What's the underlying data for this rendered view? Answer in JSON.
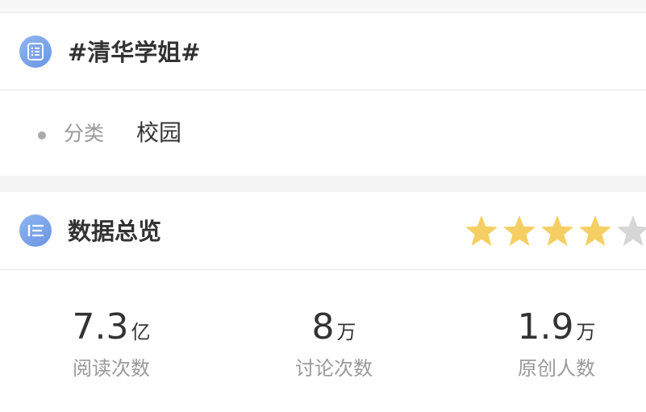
{
  "topic": {
    "title": "#清华学姐#",
    "icon": "document-list-icon"
  },
  "category": {
    "label": "分类",
    "value": "校园"
  },
  "overview": {
    "title": "数据总览",
    "icon": "list-icon",
    "rating": {
      "value": 4,
      "max": 5,
      "filled_color": "#f5cf63",
      "empty_color": "#d6d6d6"
    }
  },
  "stats": [
    {
      "number": "7.3",
      "unit": "亿",
      "label": "阅读次数"
    },
    {
      "number": "8",
      "unit": "万",
      "label": "讨论次数"
    },
    {
      "number": "1.9",
      "unit": "万",
      "label": "原创人数"
    }
  ],
  "colors": {
    "accent": "#7aa3eb",
    "divider": "#e6e6e6",
    "band": "#f3f3f3"
  }
}
